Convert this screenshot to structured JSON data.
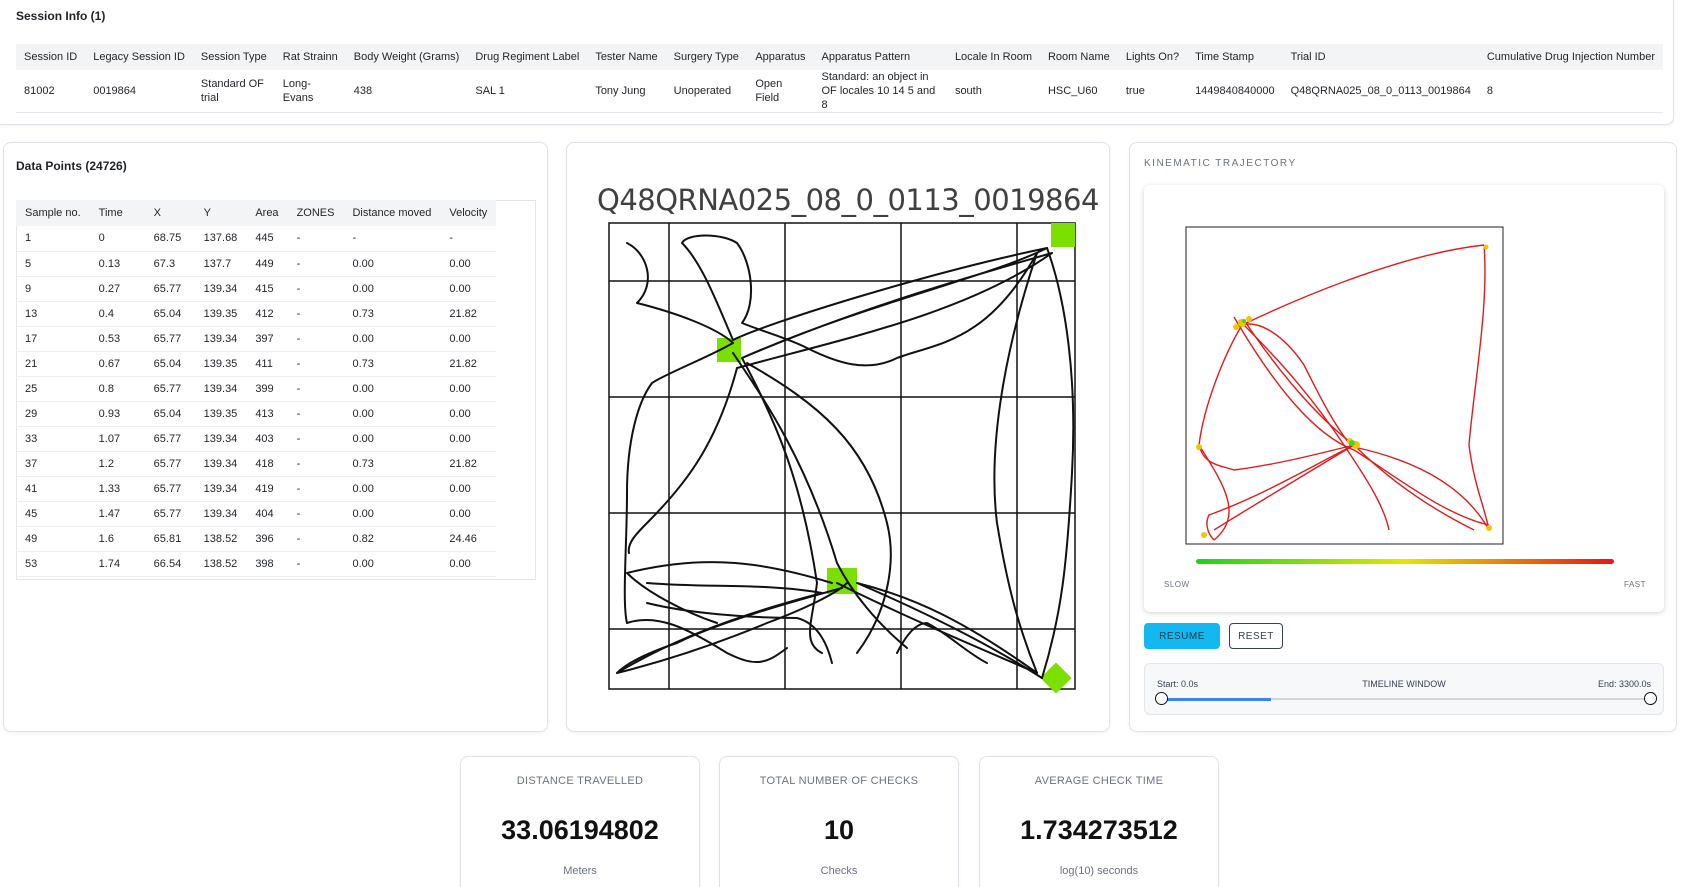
{
  "session": {
    "title": "Session Info (1)",
    "headers": [
      "Session ID",
      "Legacy Session ID",
      "Session Type",
      "Rat Strainn",
      "Body Weight (Grams)",
      "Drug Regiment Label",
      "Tester Name",
      "Surgery Type",
      "Apparatus",
      "Apparatus Pattern",
      "Locale In Room",
      "Room Name",
      "Lights On?",
      "Time Stamp",
      "Trial ID",
      "Cumulative Drug Injection Number"
    ],
    "row": [
      "81002",
      "0019864",
      "Standard OF trial",
      "Long-Evans",
      "438",
      "SAL 1",
      "Tony Jung",
      "Unoperated",
      "Open Field",
      "Standard: an object in OF locales 10 14 5 and 8",
      "south",
      "HSC_U60",
      "true",
      "1449840840000",
      "Q48QRNA025_08_0_0113_0019864",
      "8"
    ]
  },
  "data_points": {
    "title": "Data Points (24726)",
    "headers": [
      "Sample no.",
      "Time",
      "X",
      "Y",
      "Area",
      "ZONES",
      "Distance moved",
      "Velocity"
    ],
    "rows": [
      [
        "1",
        "0",
        "68.75",
        "137.68",
        "445",
        "-",
        "-",
        "-"
      ],
      [
        "5",
        "0.13",
        "67.3",
        "137.7",
        "449",
        "-",
        "0.00",
        "0.00"
      ],
      [
        "9",
        "0.27",
        "65.77",
        "139.34",
        "415",
        "-",
        "0.00",
        "0.00"
      ],
      [
        "13",
        "0.4",
        "65.04",
        "139.35",
        "412",
        "-",
        "0.73",
        "21.82"
      ],
      [
        "17",
        "0.53",
        "65.77",
        "139.34",
        "397",
        "-",
        "0.00",
        "0.00"
      ],
      [
        "21",
        "0.67",
        "65.04",
        "139.35",
        "411",
        "-",
        "0.73",
        "21.82"
      ],
      [
        "25",
        "0.8",
        "65.77",
        "139.34",
        "399",
        "-",
        "0.00",
        "0.00"
      ],
      [
        "29",
        "0.93",
        "65.04",
        "139.35",
        "413",
        "-",
        "0.00",
        "0.00"
      ],
      [
        "33",
        "1.07",
        "65.77",
        "139.34",
        "403",
        "-",
        "0.00",
        "0.00"
      ],
      [
        "37",
        "1.2",
        "65.77",
        "139.34",
        "418",
        "-",
        "0.73",
        "21.82"
      ],
      [
        "41",
        "1.33",
        "65.77",
        "139.34",
        "419",
        "-",
        "0.00",
        "0.00"
      ],
      [
        "45",
        "1.47",
        "65.77",
        "139.34",
        "404",
        "-",
        "0.00",
        "0.00"
      ],
      [
        "49",
        "1.6",
        "65.81",
        "138.52",
        "396",
        "-",
        "0.82",
        "24.46"
      ],
      [
        "53",
        "1.74",
        "66.54",
        "138.52",
        "398",
        "-",
        "0.00",
        "0.00"
      ]
    ]
  },
  "track_image": {
    "title": "Q48QRNA025_08_0_0113_0019864",
    "object_color": "#7be000",
    "path_color": "#111111"
  },
  "kinematic": {
    "title": "KINEMATIC TRAJECTORY",
    "slow_label": "SLOW",
    "fast_label": "FAST",
    "path_color": "#e01c1c",
    "resume_label": "RESUME",
    "reset_label": "RESET",
    "timeline_label": "TIMELINE WINDOW",
    "start_label": "Start: 0.0s",
    "end_label": "End: 3300.0s"
  },
  "stats": [
    {
      "label": "DISTANCE TRAVELLED",
      "value": "33.06194802",
      "unit": "Meters"
    },
    {
      "label": "TOTAL NUMBER OF CHECKS",
      "value": "10",
      "unit": "Checks"
    },
    {
      "label": "AVERAGE CHECK TIME",
      "value": "1.734273512",
      "unit": "log(10) seconds"
    }
  ]
}
